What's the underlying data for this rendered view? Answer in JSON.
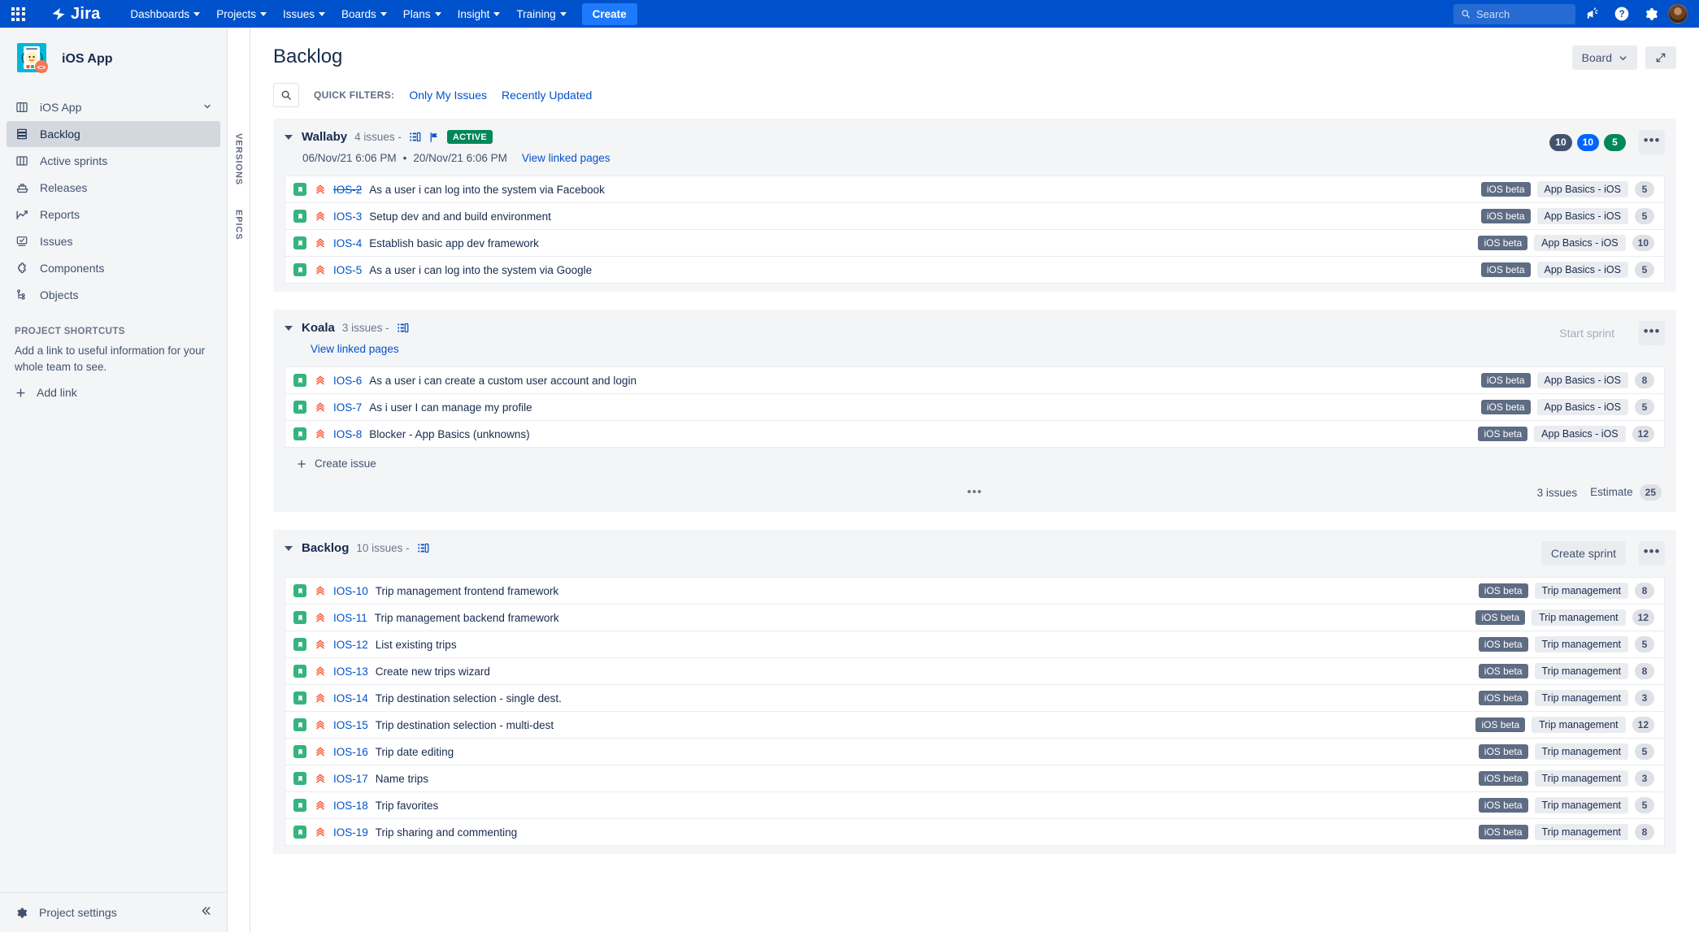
{
  "topnav": {
    "app_switcher_icon": "grid-apps-icon",
    "logo_text": "Jira",
    "items": [
      {
        "label": "Dashboards",
        "has_caret": true
      },
      {
        "label": "Projects",
        "has_caret": true
      },
      {
        "label": "Issues",
        "has_caret": true
      },
      {
        "label": "Boards",
        "has_caret": true
      },
      {
        "label": "Plans",
        "has_caret": true
      },
      {
        "label": "Insight",
        "has_caret": true
      },
      {
        "label": "Training",
        "has_caret": true
      }
    ],
    "create_label": "Create",
    "search_placeholder": "Search",
    "search_value": "",
    "icons": [
      "megaphone-icon",
      "help-icon",
      "settings-gear-icon",
      "user-avatar"
    ]
  },
  "sidebar": {
    "project_name": "iOS App",
    "items": [
      {
        "label": "iOS App",
        "icon": "board-icon",
        "active": false,
        "chevron": true
      },
      {
        "label": "Backlog",
        "icon": "backlog-icon",
        "active": true
      },
      {
        "label": "Active sprints",
        "icon": "columns-icon",
        "active": false
      },
      {
        "label": "Releases",
        "icon": "releases-ship-icon",
        "active": false
      },
      {
        "label": "Reports",
        "icon": "reports-chart-icon",
        "active": false
      },
      {
        "label": "Issues",
        "icon": "issues-screen-icon",
        "active": false
      },
      {
        "label": "Components",
        "icon": "components-puzzle-icon",
        "active": false
      },
      {
        "label": "Objects",
        "icon": "objects-tree-icon",
        "active": false
      }
    ],
    "shortcuts_title": "PROJECT SHORTCUTS",
    "shortcuts_text": "Add a link to useful information for your whole team to see.",
    "add_link_label": "Add link",
    "project_settings_label": "Project settings",
    "collapse_icon": "double-chevron-left-icon"
  },
  "rail": {
    "labels": [
      "VERSIONS",
      "EPICS"
    ]
  },
  "header": {
    "title": "Backlog",
    "board_button": "Board",
    "expand_icon": "fullscreen-expand-icon"
  },
  "filters": {
    "search_icon": "search-icon",
    "label": "QUICK FILTERS:",
    "links": [
      "Only My Issues",
      "Recently Updated"
    ]
  },
  "colors": {
    "brand_blue": "#0052CC",
    "create_blue": "#1D7AFC",
    "link_blue": "#0052CC",
    "active_green": "#00875A",
    "story_green": "#36B37E",
    "priority_red": "#FF5630",
    "version_tag": "#5E6C84",
    "sidebar_bg": "#F4F5F7"
  },
  "sections": [
    {
      "name": "Wallaby",
      "issue_count_label": "4 issues",
      "separator": "-",
      "has_board_icon": true,
      "has_flag_icon": true,
      "status_badge": "ACTIVE",
      "start_date": "06/Nov/21 6:06 PM",
      "date_separator": "•",
      "end_date": "20/Nov/21 6:06 PM",
      "linked_pages_label": "View linked pages",
      "pills": [
        {
          "value": "10",
          "color": "grey"
        },
        {
          "value": "10",
          "color": "blue"
        },
        {
          "value": "5",
          "color": "green"
        }
      ],
      "action_button": null,
      "more_icon": "more-options-icon",
      "show_create_issue": false,
      "footer": null,
      "issues": [
        {
          "key": "IOS-2",
          "done": true,
          "summary": "As a user i can log into the system via Facebook",
          "version": "iOS beta",
          "epic": "App Basics - iOS",
          "estimate": "5"
        },
        {
          "key": "IOS-3",
          "done": false,
          "summary": "Setup dev and and build environment",
          "version": "iOS beta",
          "epic": "App Basics - iOS",
          "estimate": "5"
        },
        {
          "key": "IOS-4",
          "done": false,
          "summary": "Establish basic app dev framework",
          "version": "iOS beta",
          "epic": "App Basics - iOS",
          "estimate": "10"
        },
        {
          "key": "IOS-5",
          "done": false,
          "summary": "As a user i can log into the system via Google",
          "version": "iOS beta",
          "epic": "App Basics - iOS",
          "estimate": "5"
        }
      ]
    },
    {
      "name": "Koala",
      "issue_count_label": "3 issues",
      "separator": "-",
      "has_board_icon": true,
      "has_flag_icon": false,
      "status_badge": null,
      "start_date": null,
      "date_separator": null,
      "end_date": null,
      "linked_pages_label": "View linked pages",
      "pills": [],
      "action_button": {
        "label": "Start sprint",
        "disabled": true
      },
      "more_icon": "more-options-icon",
      "show_create_issue": true,
      "create_issue_label": "Create issue",
      "footer": {
        "dots": "•••",
        "issues_text": "3 issues",
        "estimate_label": "Estimate",
        "estimate_value": "25"
      },
      "issues": [
        {
          "key": "IOS-6",
          "done": false,
          "summary": "As a user i can create a custom user account and login",
          "version": "iOS beta",
          "epic": "App Basics - iOS",
          "estimate": "8"
        },
        {
          "key": "IOS-7",
          "done": false,
          "summary": "As i user I can manage my profile",
          "version": "iOS beta",
          "epic": "App Basics - iOS",
          "estimate": "5"
        },
        {
          "key": "IOS-8",
          "done": false,
          "summary": "Blocker - App Basics (unknowns)",
          "version": "iOS beta",
          "epic": "App Basics - iOS",
          "estimate": "12"
        }
      ]
    },
    {
      "name": "Backlog",
      "issue_count_label": "10 issues",
      "separator": "-",
      "has_board_icon": true,
      "has_flag_icon": false,
      "status_badge": null,
      "start_date": null,
      "date_separator": null,
      "end_date": null,
      "linked_pages_label": null,
      "pills": [],
      "action_button": {
        "label": "Create sprint",
        "disabled": false
      },
      "more_icon": "more-options-icon",
      "show_create_issue": false,
      "footer": null,
      "issues": [
        {
          "key": "IOS-10",
          "done": false,
          "summary": "Trip management frontend framework",
          "version": "iOS beta",
          "epic": "Trip management",
          "estimate": "8"
        },
        {
          "key": "IOS-11",
          "done": false,
          "summary": "Trip management backend framework",
          "version": "iOS beta",
          "epic": "Trip management",
          "estimate": "12"
        },
        {
          "key": "IOS-12",
          "done": false,
          "summary": "List existing trips",
          "version": "iOS beta",
          "epic": "Trip management",
          "estimate": "5"
        },
        {
          "key": "IOS-13",
          "done": false,
          "summary": "Create new trips wizard",
          "version": "iOS beta",
          "epic": "Trip management",
          "estimate": "8"
        },
        {
          "key": "IOS-14",
          "done": false,
          "summary": "Trip destination selection - single dest.",
          "version": "iOS beta",
          "epic": "Trip management",
          "estimate": "3"
        },
        {
          "key": "IOS-15",
          "done": false,
          "summary": "Trip destination selection - multi-dest",
          "version": "iOS beta",
          "epic": "Trip management",
          "estimate": "12"
        },
        {
          "key": "IOS-16",
          "done": false,
          "summary": "Trip date editing",
          "version": "iOS beta",
          "epic": "Trip management",
          "estimate": "5"
        },
        {
          "key": "IOS-17",
          "done": false,
          "summary": "Name trips",
          "version": "iOS beta",
          "epic": "Trip management",
          "estimate": "3"
        },
        {
          "key": "IOS-18",
          "done": false,
          "summary": "Trip favorites",
          "version": "iOS beta",
          "epic": "Trip management",
          "estimate": "5"
        },
        {
          "key": "IOS-19",
          "done": false,
          "summary": "Trip sharing and commenting",
          "version": "iOS beta",
          "epic": "Trip management",
          "estimate": "8"
        }
      ]
    }
  ]
}
